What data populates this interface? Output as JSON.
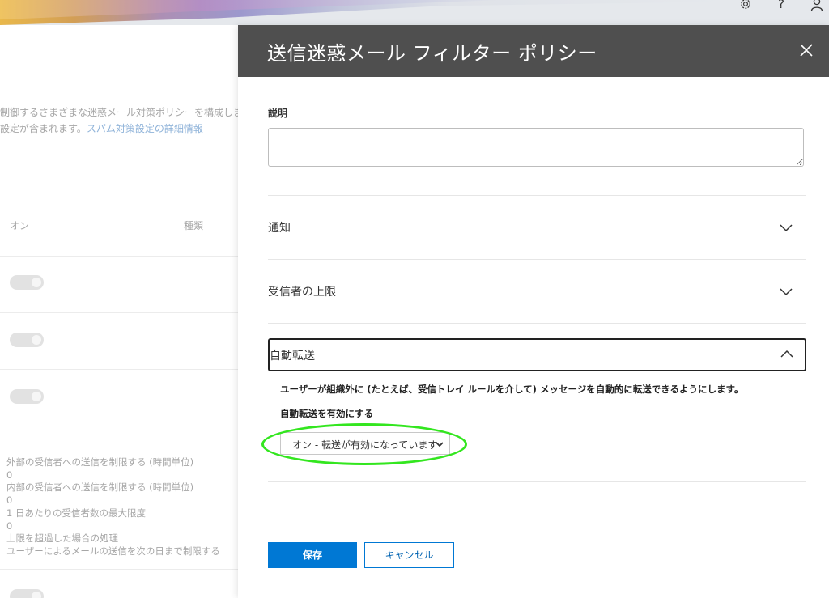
{
  "topbar": {
    "settings_icon": "gear-icon",
    "help_icon": "question-mark-icon",
    "help_glyph": "?",
    "account_icon": "person-icon"
  },
  "background_page": {
    "description_line1": "制御するさまざまな迷惑メール対策ポリシーを構成します。(",
    "description_line2": "設定が含まれます。",
    "learn_more_link": "スパム対策設定の詳細情報",
    "col_on": "オン",
    "col_type": "種類",
    "details": [
      "外部の受信者への送信を制限する (時間単位)",
      "0",
      "内部の受信者への送信を制限する (時間単位)",
      "0",
      "1 日あたりの受信者数の最大限度",
      "0",
      "上限を超過した場合の処理",
      "ユーザーによるメールの送信を次の日まで制限する"
    ]
  },
  "panel": {
    "title": "送信迷惑メール フィルター ポリシー",
    "close_glyph": "✕",
    "description_label": "説明",
    "description_value": "",
    "sections": [
      {
        "label": "通知",
        "expanded": false
      },
      {
        "label": "受信者の上限",
        "expanded": false
      },
      {
        "label": "自動転送",
        "expanded": true
      }
    ],
    "auto_forward": {
      "description": "ユーザーが組織外に (たとえば、受信トレイ ルールを介して) メッセージを自動的に転送できるようにします。",
      "enable_label": "自動転送を有効にする",
      "selected_option": "オン - 転送が有効になっています"
    },
    "save_label": "保存",
    "cancel_label": "キャンセル"
  },
  "colors": {
    "header_bg": "#4f4f4f",
    "primary_button": "#0078d4",
    "highlight": "#33e61f"
  }
}
